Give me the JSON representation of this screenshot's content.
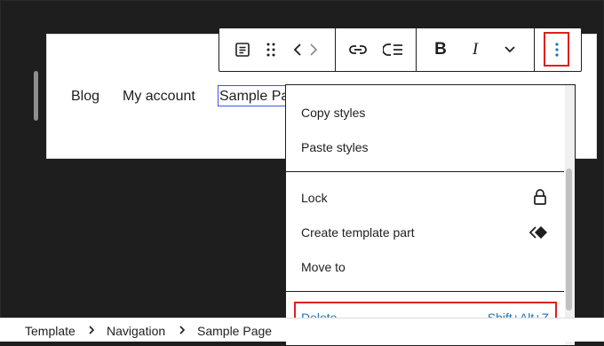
{
  "navigation": {
    "items": [
      "Blog",
      "My account",
      "Sample Page"
    ]
  },
  "toolbar": {
    "icons": [
      "paragraph-icon",
      "drag-handle-icon",
      "chevron-left-icon",
      "chevron-right-icon",
      "link-icon",
      "submenu-icon",
      "bold-icon",
      "italic-icon",
      "chevron-down-icon",
      "more-options-icon"
    ],
    "bold_label": "B",
    "italic_label": "I"
  },
  "menu": {
    "copy_styles": "Copy styles",
    "paste_styles": "Paste styles",
    "lock": "Lock",
    "create_template_part": "Create template part",
    "move_to": "Move to",
    "delete": "Delete",
    "delete_shortcut": "Shift+Alt+Z"
  },
  "breadcrumb": [
    "Template",
    "Navigation",
    "Sample Page"
  ],
  "colors": {
    "highlight": "#e01e1e",
    "accent": "#2271b1",
    "selection": "#3858e9",
    "dark": "#1e1e1e"
  }
}
